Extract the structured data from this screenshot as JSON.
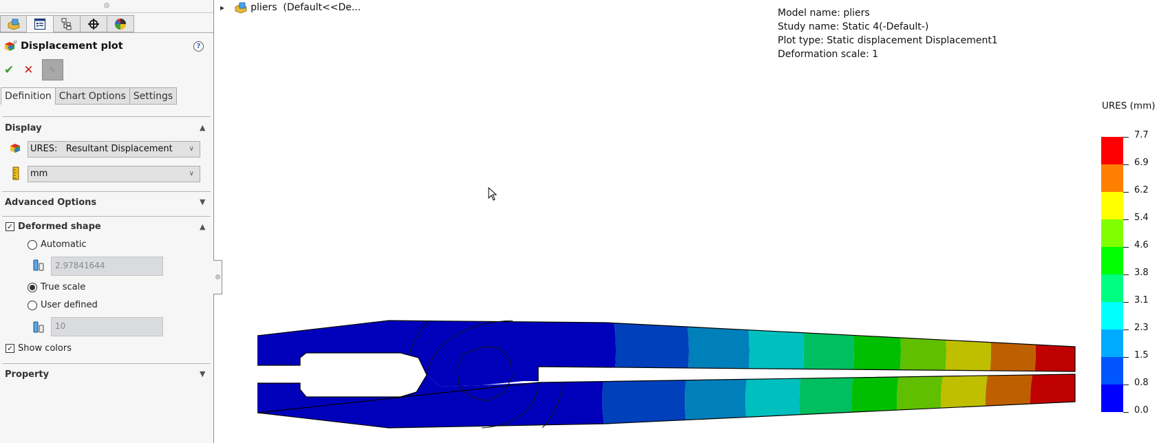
{
  "panel": {
    "manager_tabs": [
      {
        "name": "feature-manager",
        "icon": "part-cube-icon"
      },
      {
        "name": "property-manager",
        "icon": "property-list-icon"
      },
      {
        "name": "configuration-manager",
        "icon": "configuration-tree-icon"
      },
      {
        "name": "dimxpert-manager",
        "icon": "crosshair-icon"
      },
      {
        "name": "display-manager",
        "icon": "appearance-sphere-icon"
      }
    ],
    "active_manager_tab": 1,
    "title": "Displacement plot",
    "help_label": "?",
    "ok_label": "✔",
    "cancel_label": "✕",
    "pin_label": "📌",
    "tabs": [
      "Definition",
      "Chart Options",
      "Settings"
    ],
    "active_tab": "Definition",
    "display": {
      "title": "Display",
      "component_select": "URES:   Resultant Displacement",
      "unit_select": "mm"
    },
    "advanced_options": {
      "title": "Advanced Options"
    },
    "deformed_shape": {
      "title": "Deformed shape",
      "checked": true,
      "options": [
        {
          "label": "Automatic",
          "selected": false,
          "value": "2.97841644"
        },
        {
          "label": "True scale",
          "selected": true
        },
        {
          "label": "User defined",
          "selected": false,
          "value": "10"
        }
      ]
    },
    "show_colors": {
      "label": "Show colors",
      "checked": true
    },
    "property": {
      "title": "Property"
    }
  },
  "tree": {
    "item_label": "pliers  (Default<<De..."
  },
  "info": {
    "lines": [
      "Model name: pliers",
      "Study name: Static 4(-Default-)",
      "Plot type: Static displacement Displacement1",
      "Deformation scale: 1"
    ]
  },
  "chart_data": {
    "type": "heatmap",
    "title": "URES (mm)",
    "legend_position": "right",
    "legend_labels": [
      "7.7",
      "6.9",
      "6.2",
      "5.4",
      "4.6",
      "3.8",
      "3.1",
      "2.3",
      "1.5",
      "0.8",
      "0.0"
    ],
    "range": [
      0.0,
      7.7
    ],
    "colors_top_to_bottom": [
      "#ff0000",
      "#ff8000",
      "#ffff00",
      "#80ff00",
      "#00ff00",
      "#00ff80",
      "#00ffff",
      "#00aaff",
      "#0055ff",
      "#0000ff"
    ],
    "model_band_colors": [
      "#0000bb",
      "#0040bb",
      "#0080bb",
      "#00bfbf",
      "#00bf60",
      "#00bf00",
      "#60bf00",
      "#bfbf00",
      "#bf6000",
      "#bf0000"
    ],
    "model_band_values_mm": [
      0.4,
      1.15,
      1.9,
      2.7,
      3.45,
      4.2,
      5.0,
      5.8,
      6.55,
      7.3
    ]
  }
}
